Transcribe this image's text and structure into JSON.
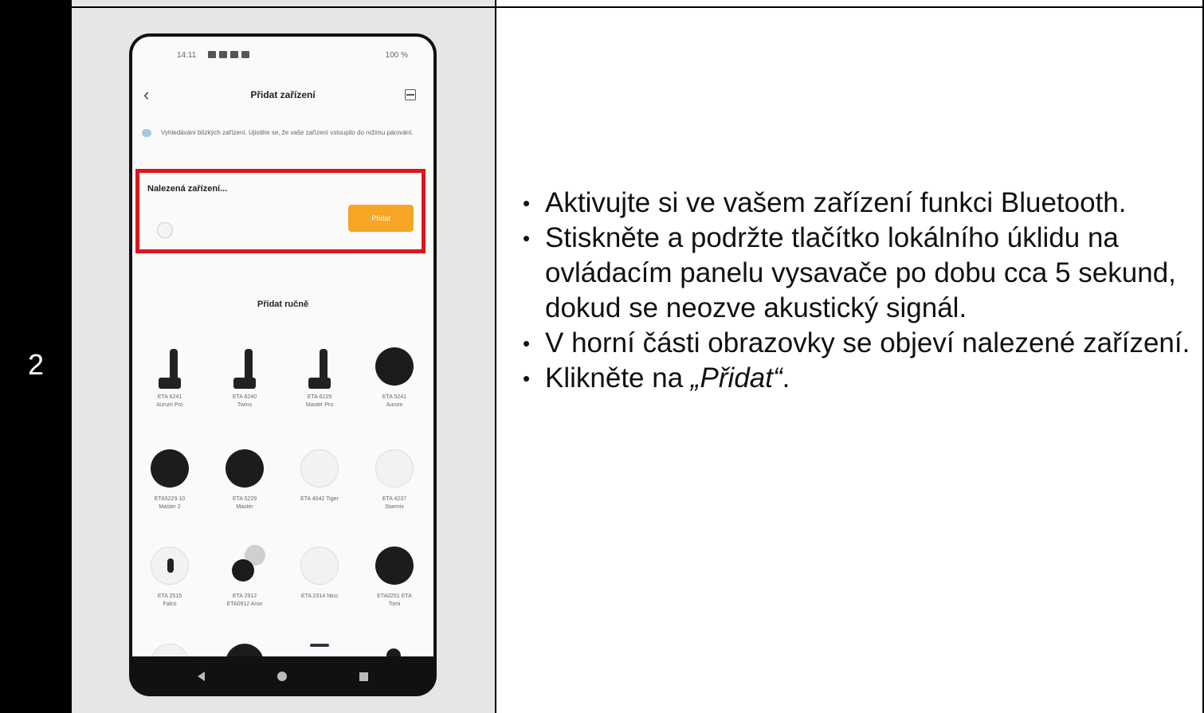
{
  "step": {
    "number": "2"
  },
  "phone": {
    "status": {
      "time": "14:11",
      "right": "100 %"
    },
    "title": "Přidat zařízení",
    "search_msg": "Vyhledávání blízkých zařízení. Ujistěte se, že vaše zařízení vstoupilo do režimu párování.",
    "found_label": "Nalezená zařízení...",
    "add_button": "Přidat",
    "manual_title": "Přidat ručně",
    "devices": [
      {
        "name": "ETA 6241",
        "sub": "Aurum Pro",
        "icon": "dock-station-icon"
      },
      {
        "name": "ETA 6240",
        "sub": "Twins",
        "icon": "dock-station-icon"
      },
      {
        "name": "ETA 6229",
        "sub": "Master Pro",
        "icon": "dock-station-icon"
      },
      {
        "name": "ETA 5241",
        "sub": "Aurum",
        "icon": "robot-vacuum-black-icon"
      },
      {
        "name": "ETA5229 10",
        "sub": "Master 2",
        "icon": "robot-vacuum-black-icon"
      },
      {
        "name": "ETA 5229",
        "sub": "Master",
        "icon": "robot-vacuum-black-icon"
      },
      {
        "name": "ETA 4042 Tiger",
        "sub": "",
        "icon": "robot-vacuum-white-icon"
      },
      {
        "name": "ETA 4237",
        "sub": "Starmix",
        "icon": "robot-vacuum-white-icon"
      },
      {
        "name": "ETA 2515",
        "sub": "Falco",
        "icon": "robot-vacuum-white-icon"
      },
      {
        "name": "ETA 2912",
        "sub": "ETA0912 Aron",
        "icon": "robot-vacuum-pair-icon"
      },
      {
        "name": "ETA 2314 Nico",
        "sub": "",
        "icon": "robot-vacuum-white-icon"
      },
      {
        "name": "ETA0251 ETA",
        "sub": "Tomi",
        "icon": "robot-vacuum-black-icon"
      }
    ]
  },
  "instructions": {
    "item1": "Aktivujte si ve vašem zařízení funkci Bluetooth.",
    "item2": "Stiskněte a podržte tlačítko lokálního úklidu na ovládacím panelu vysavače po dobu cca 5 sekund, dokud se neozve akustický signál.",
    "item3": "V horní části obrazovky se objeví nalezené zařízení.",
    "item4_prefix": "Klikněte na ",
    "item4_em": "„Přidat“",
    "item4_suffix": "."
  },
  "colors": {
    "highlight": "#e0141c",
    "add_button": "#f7a525"
  }
}
